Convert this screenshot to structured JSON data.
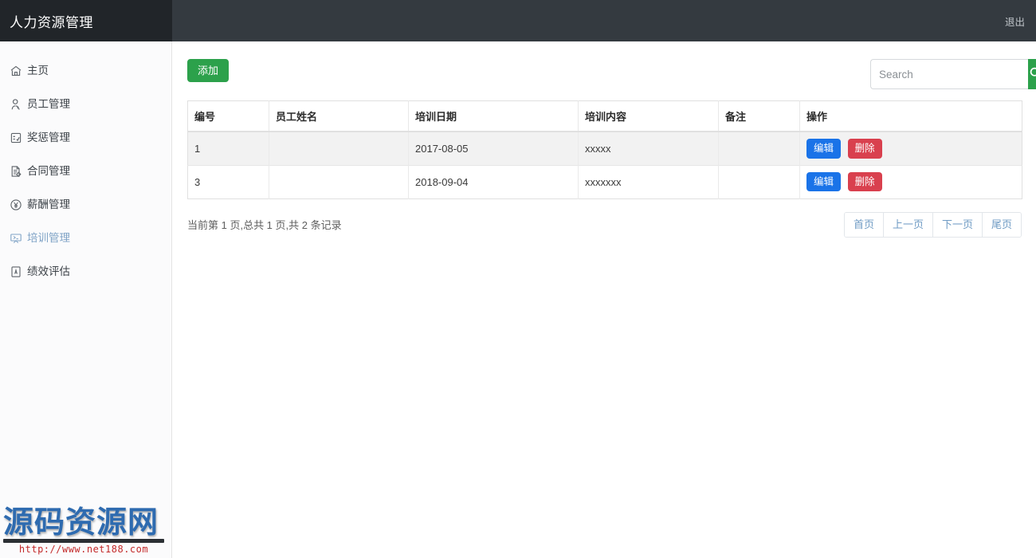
{
  "header": {
    "brand_title": "人力资源管理",
    "logout_label": "退出"
  },
  "sidebar": {
    "items": [
      {
        "label": "主页",
        "icon": "home-icon",
        "active": false
      },
      {
        "label": "员工管理",
        "icon": "user-icon",
        "active": false
      },
      {
        "label": "奖惩管理",
        "icon": "award-icon",
        "active": false
      },
      {
        "label": "合同管理",
        "icon": "contract-icon",
        "active": false
      },
      {
        "label": "薪酬管理",
        "icon": "currency-icon",
        "active": false
      },
      {
        "label": "培训管理",
        "icon": "training-icon",
        "active": true
      },
      {
        "label": "绩效评估",
        "icon": "assessment-icon",
        "active": false
      }
    ]
  },
  "toolbar": {
    "add_label": "添加",
    "search_placeholder": "Search",
    "search_value": "",
    "search_icon": "search-icon"
  },
  "table": {
    "columns": [
      "编号",
      "员工姓名",
      "培训日期",
      "培训内容",
      "备注",
      "操作"
    ],
    "rows": [
      {
        "id": "1",
        "name": "",
        "date": "2017-08-05",
        "content": "xxxxx",
        "note": "",
        "edit_label": "编辑",
        "delete_label": "删除"
      },
      {
        "id": "3",
        "name": "",
        "date": "2018-09-04",
        "content": "xxxxxxx",
        "note": "",
        "edit_label": "编辑",
        "delete_label": "删除"
      }
    ]
  },
  "footer": {
    "page_info": "当前第 1 页,总共 1 页,共 2 条记录",
    "pager": [
      "首页",
      "上一页",
      "下一页",
      "尾页"
    ]
  },
  "watermark": {
    "title": "源码资源网",
    "url": "http://www.net188.com"
  },
  "colors": {
    "navbar": "#343a40",
    "brand": "#212529",
    "add_button": "#2ca14b",
    "edit_button": "#1a73e8",
    "delete_button": "#d9404e",
    "active_nav": "#7fa3c6",
    "pager_link": "#6f9bc4"
  }
}
